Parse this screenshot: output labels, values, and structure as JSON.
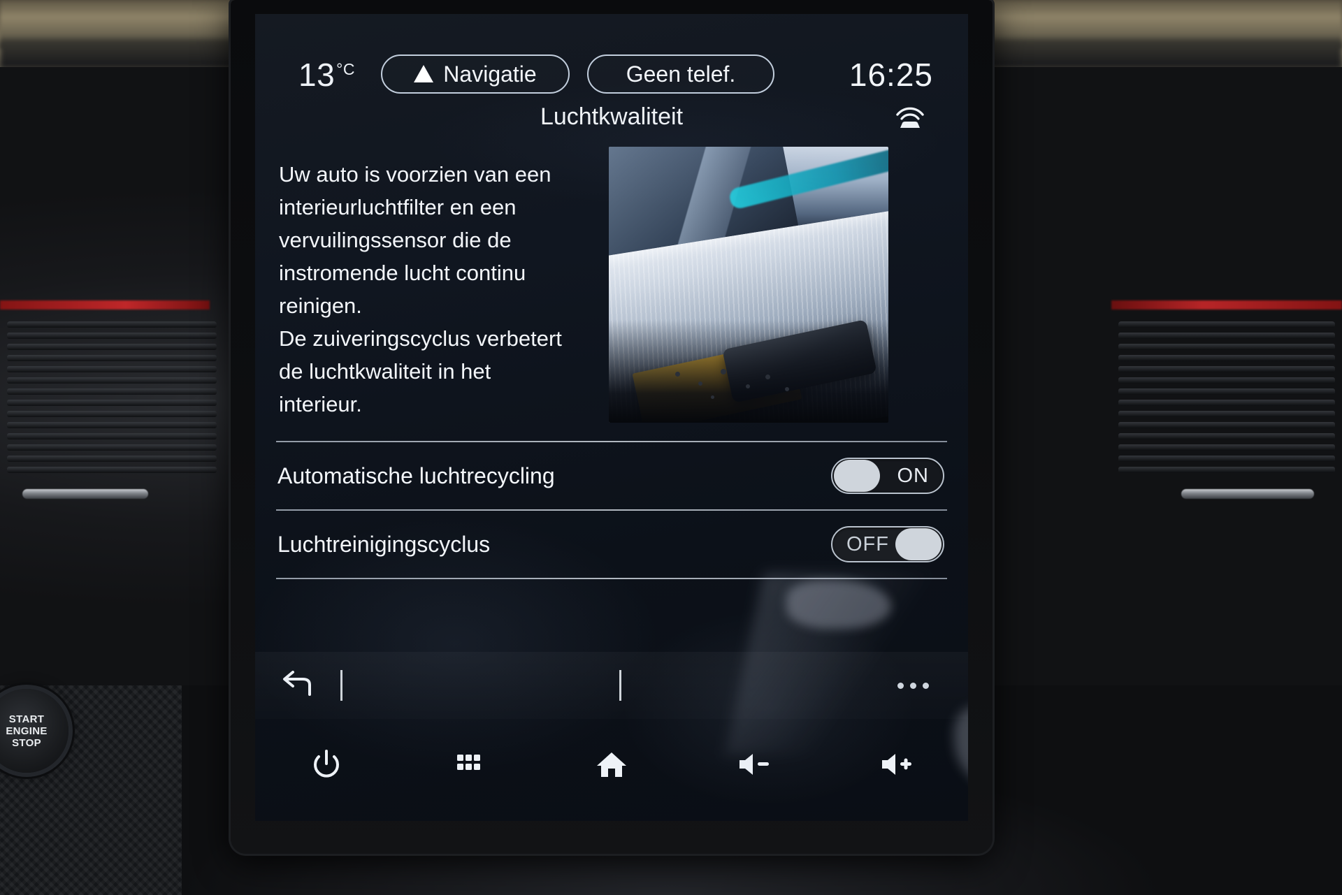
{
  "device": "renault-easylink-infotainment",
  "status_bar": {
    "temperature": "13",
    "temperature_unit": "°C",
    "nav_pill_label": "Navigatie",
    "phone_pill_label": "Geen telef.",
    "clock": "16:25",
    "connectivity_icon": "connected-car-wifi-icon"
  },
  "page": {
    "title": "Luchtkwaliteit",
    "description_line1": "Uw auto is voorzien van een",
    "description_line2": "interieurluchtfilter en een",
    "description_line3": "vervuilingssensor die de",
    "description_line4": "instromende lucht continu",
    "description_line5": "reinigen.",
    "description_line6": "De zuiveringscyclus verbetert",
    "description_line7": "de luchtkwaliteit in het",
    "description_line8": "interieur.",
    "illustration_alt": "dashboard-dust-illustration"
  },
  "settings": [
    {
      "label": "Automatische luchtrecycling",
      "state": "ON",
      "on": true
    },
    {
      "label": "Luchtreinigingscyclus",
      "state": "OFF",
      "on": false
    }
  ],
  "app_bar": {
    "back_icon": "back-arrow-icon",
    "overflow_icon": "more-options-icon"
  },
  "nav_bar": {
    "buttons": [
      {
        "icon": "power-icon",
        "name": "power-button"
      },
      {
        "icon": "apps-grid-icon",
        "name": "apps-button"
      },
      {
        "icon": "home-icon",
        "name": "home-button"
      },
      {
        "icon": "volume-down-icon",
        "name": "volume-down-button"
      },
      {
        "icon": "volume-up-icon",
        "name": "volume-up-button"
      }
    ]
  },
  "vehicle": {
    "start_stop_line1": "START",
    "start_stop_line2": "ENGINE",
    "start_stop_line3": "STOP"
  },
  "colors": {
    "screen_bg": "#0c1119",
    "text": "#f3f6fa",
    "accent_trim": "#c8282a",
    "toggle_knob": "#cfd5dc"
  }
}
